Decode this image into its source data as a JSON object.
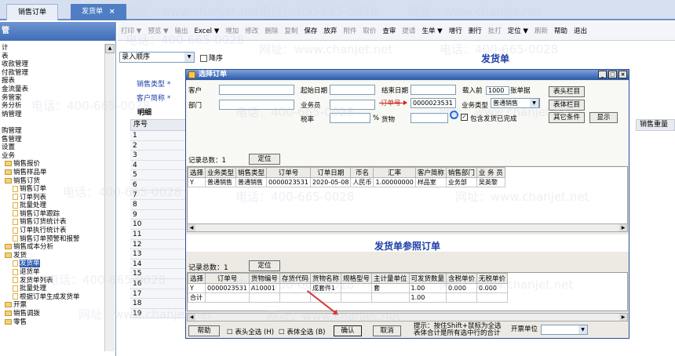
{
  "tabs": [
    {
      "label": "销售订单"
    },
    {
      "label": "发货单",
      "close": "×"
    }
  ],
  "left_header": "管",
  "tree": [
    {
      "label": "计",
      "type": "plain"
    },
    {
      "label": "表",
      "type": "plain"
    },
    {
      "label": "收款管理",
      "type": "plain"
    },
    {
      "label": "付款管理",
      "type": "plain"
    },
    {
      "label": "报表",
      "type": "plain"
    },
    {
      "label": "金流量表",
      "type": "plain"
    },
    {
      "label": "务管家",
      "type": "plain"
    },
    {
      "label": "务分析",
      "type": "plain"
    },
    {
      "label": "纳管理",
      "type": "plain"
    },
    {
      "label": "",
      "type": "plain"
    },
    {
      "label": "购管理",
      "type": "plain"
    },
    {
      "label": "售管理",
      "type": "plain"
    },
    {
      "label": "设置",
      "type": "plain"
    },
    {
      "label": "业务",
      "type": "plain"
    },
    {
      "label": "销售报价",
      "type": "fold",
      "indent": 4
    },
    {
      "label": "销售样品单",
      "type": "fold",
      "indent": 4
    },
    {
      "label": "销售订货",
      "type": "fold",
      "indent": 4
    },
    {
      "label": "销售订单",
      "type": "doc",
      "indent": 14
    },
    {
      "label": "订单列表",
      "type": "doc",
      "indent": 14
    },
    {
      "label": "批量处理",
      "type": "doc",
      "indent": 14
    },
    {
      "label": "销售订单跟踪",
      "type": "doc",
      "indent": 14
    },
    {
      "label": "销售订货统计表",
      "type": "doc",
      "indent": 14
    },
    {
      "label": "订单执行统计表",
      "type": "doc",
      "indent": 14
    },
    {
      "label": "销售订单预警和报警",
      "type": "doc",
      "indent": 14
    },
    {
      "label": "销售成本分析",
      "type": "fold",
      "indent": 4
    },
    {
      "label": "发货",
      "type": "fold",
      "indent": 4
    },
    {
      "label": "发货单",
      "type": "doc",
      "indent": 14,
      "selected": true
    },
    {
      "label": "退货单",
      "type": "doc",
      "indent": 14
    },
    {
      "label": "发货单列表",
      "type": "doc",
      "indent": 14
    },
    {
      "label": "批量处理",
      "type": "doc",
      "indent": 14
    },
    {
      "label": "根据订单生成发货单",
      "type": "doc",
      "indent": 14
    },
    {
      "label": "开票",
      "type": "fold",
      "indent": 4
    },
    {
      "label": "销售调拨",
      "type": "fold",
      "indent": 4
    },
    {
      "label": "零售",
      "type": "fold",
      "indent": 4
    }
  ],
  "toolbar": [
    "打印 ▼",
    "预览 ▼",
    "输出",
    "Excel ▼",
    "增加",
    "修改",
    "删除",
    "复制",
    "保存",
    "放弃",
    "附件",
    "取价",
    "查审",
    "提请",
    "生单 ▼",
    "增行",
    "删行",
    "批打",
    "定位 ▼",
    "刷新",
    "帮助",
    "退出"
  ],
  "toolbar_disabled": [
    true,
    true,
    true,
    false,
    true,
    true,
    true,
    true,
    false,
    false,
    true,
    true,
    false,
    true,
    false,
    false,
    false,
    true,
    false,
    true,
    false,
    false
  ],
  "sort_select": "录入顺序",
  "desc_label": "降序",
  "form_title": "发货单",
  "label_sales_type": "销售类型 *",
  "label_customer": "客户简称 *",
  "label_detail": "明细",
  "grid_header": "序号",
  "grid_rows": [
    "1",
    "2",
    "3",
    "4",
    "5",
    "6",
    "7",
    "8",
    "9",
    "10",
    "11",
    "12",
    "13",
    "14",
    "15",
    "16",
    "17",
    "18",
    "19"
  ],
  "qty_header": "销售重量",
  "dialog": {
    "title": "选择订单",
    "win_btns": [
      "_",
      "□",
      "×"
    ],
    "customer_label": "客户",
    "dept_label": "部门",
    "start_date_label": "起始日期",
    "end_date_label": "结束日期",
    "load_prefix": "载入前",
    "load_value": "1000",
    "load_suffix": "张单据",
    "salesman_label": "业务员",
    "order_no_label": "订单号",
    "order_no_value": "0000023531",
    "biz_type_label": "业务类型",
    "biz_type_value": "普通销售",
    "tax_label": "税率",
    "pct": "%",
    "goods_label": "货物",
    "include_label": "包含发货已完成",
    "btn_head": "表头栏目",
    "btn_body": "表体栏目",
    "btn_other": "其它条件",
    "btn_show": "显示",
    "count_label": "记录总数：1",
    "locate": "定位",
    "upper_headers": [
      "选择",
      "业务类型",
      "销售类型",
      "订单号",
      "订单日期",
      "币名",
      "汇率",
      "客户简称",
      "销售部门",
      "业 务 员"
    ],
    "upper_rows": [
      [
        "Y",
        "普通销售",
        "普通销售",
        "0000023531",
        "2020-05-08",
        "人民币",
        "1.00000000",
        "样品室",
        "业务部",
        "吴英黎"
      ]
    ],
    "ref_title": "发货单参照订单",
    "ref_count": "记录总数：1",
    "ref_locate": "定位",
    "lower_headers": [
      "选择",
      "订单号",
      "货物编号",
      "存货代码",
      "货物名称",
      "规格型号",
      "主计量单位",
      "可发货数量",
      "含税单价",
      "无税单价"
    ],
    "lower_rows": [
      [
        "Y",
        "0000023531",
        "A10001",
        "",
        "成套件1",
        "",
        "套",
        "1.00",
        "0.000",
        "0.000"
      ],
      [
        "合计",
        "",
        "",
        "",
        "",
        "",
        "",
        "1.00",
        "",
        ""
      ]
    ],
    "btn_help": "帮助",
    "chk_head_all": "表头全选 (H)",
    "chk_body_all": "表体全选 (B)",
    "btn_ok": "确认",
    "btn_cancel": "取消",
    "tip": "提示：按住Shift+鼠标为全选 表体合计是所有选中行的合计",
    "invoice_unit_label": "开票单位"
  },
  "watermarks": [
    "网址：www.chanjet.net",
    "电话：400-665-0028"
  ]
}
